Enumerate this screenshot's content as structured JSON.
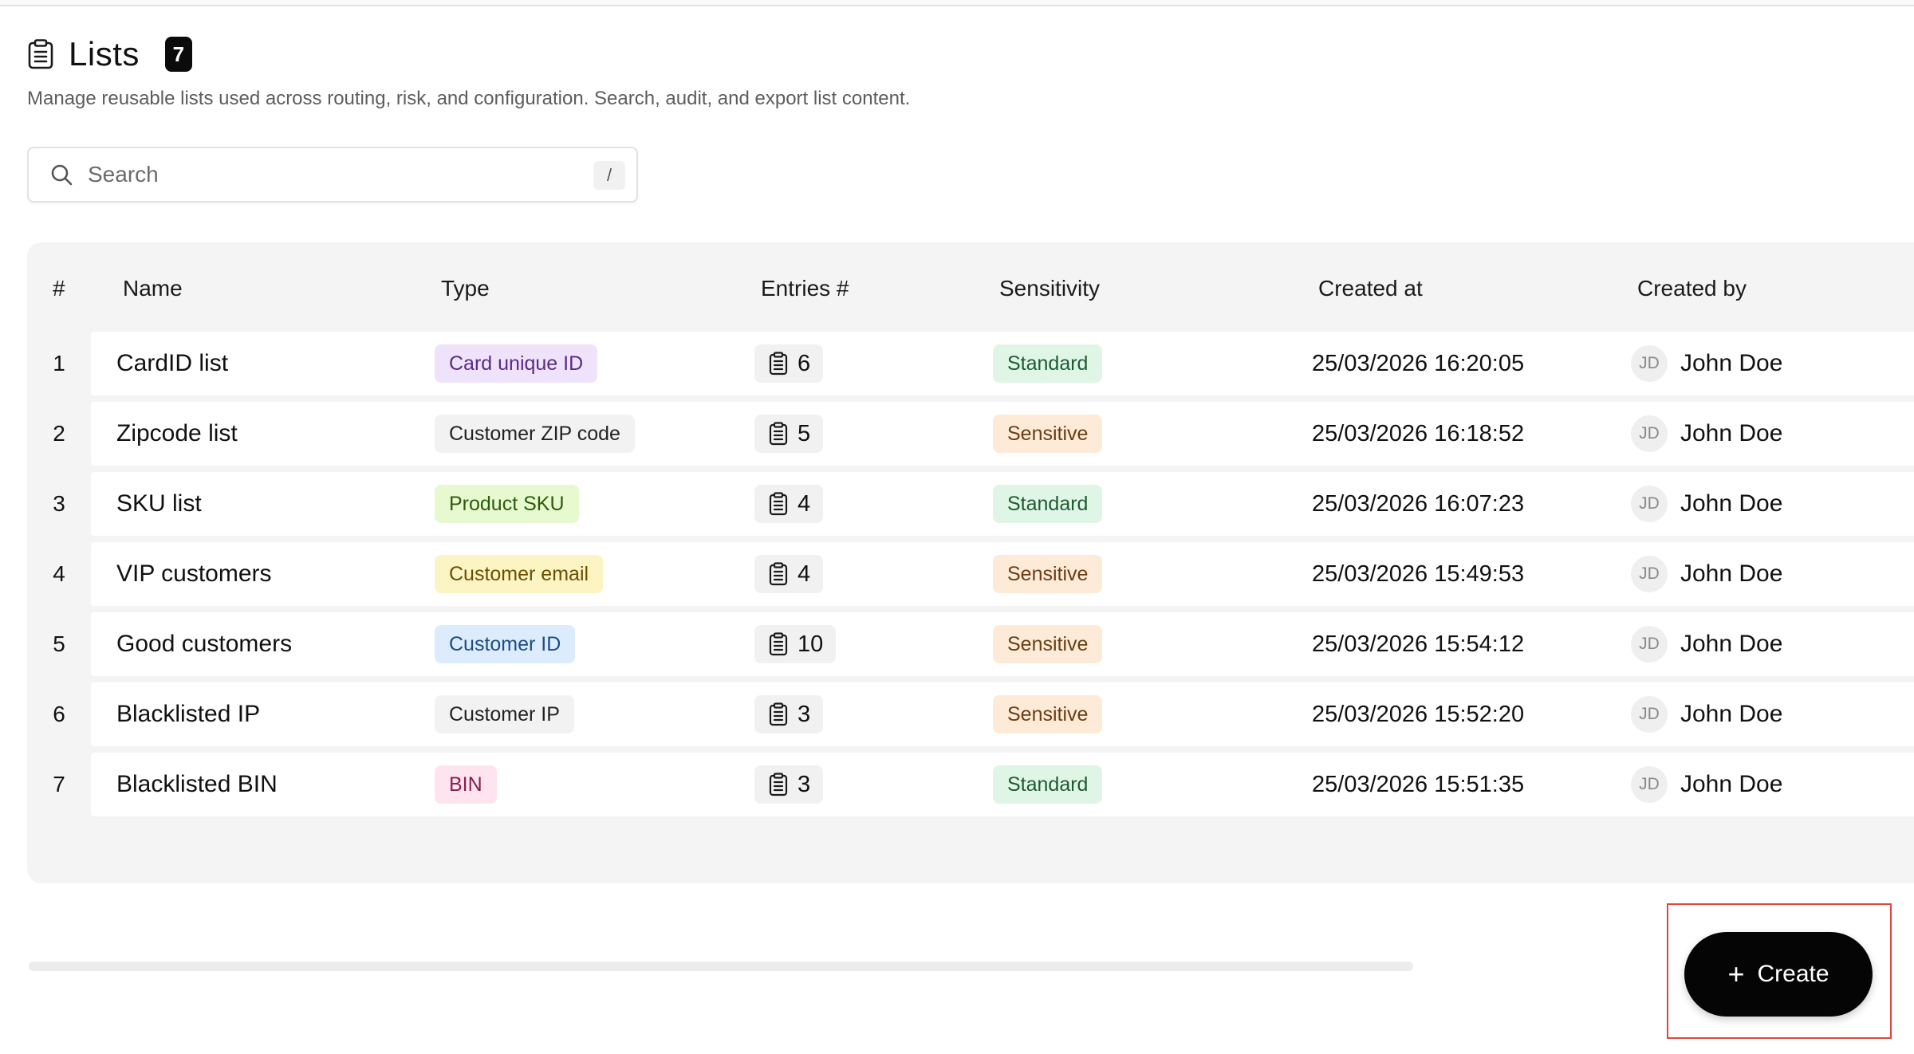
{
  "header": {
    "title": "Lists",
    "count": "7",
    "description": "Manage reusable lists used across routing, risk, and configuration. Search, audit, and export list content."
  },
  "search": {
    "placeholder": "Search",
    "shortcut": "/"
  },
  "table": {
    "columns": [
      "#",
      "Name",
      "Type",
      "Entries #",
      "Sensitivity",
      "Created at",
      "Created by"
    ],
    "rows": [
      {
        "num": "1",
        "name": "CardID list",
        "type": "Card unique ID",
        "entries": "6",
        "sensitivity": "Standard",
        "created_at": "25/03/2026 16:20:05",
        "initials": "JD",
        "created_by": "John Doe"
      },
      {
        "num": "2",
        "name": "Zipcode list",
        "type": "Customer ZIP code",
        "entries": "5",
        "sensitivity": "Sensitive",
        "created_at": "25/03/2026 16:18:52",
        "initials": "JD",
        "created_by": "John Doe"
      },
      {
        "num": "3",
        "name": "SKU list",
        "type": "Product SKU",
        "entries": "4",
        "sensitivity": "Standard",
        "created_at": "25/03/2026 16:07:23",
        "initials": "JD",
        "created_by": "John Doe"
      },
      {
        "num": "4",
        "name": "VIP customers",
        "type": "Customer email",
        "entries": "4",
        "sensitivity": "Sensitive",
        "created_at": "25/03/2026 15:49:53",
        "initials": "JD",
        "created_by": "John Doe"
      },
      {
        "num": "5",
        "name": "Good customers",
        "type": "Customer ID",
        "entries": "10",
        "sensitivity": "Sensitive",
        "created_at": "25/03/2026 15:54:12",
        "initials": "JD",
        "created_by": "John Doe"
      },
      {
        "num": "6",
        "name": "Blacklisted IP",
        "type": "Customer IP",
        "entries": "3",
        "sensitivity": "Sensitive",
        "created_at": "25/03/2026 15:52:20",
        "initials": "JD",
        "created_by": "John Doe"
      },
      {
        "num": "7",
        "name": "Blacklisted BIN",
        "type": "BIN",
        "entries": "3",
        "sensitivity": "Standard",
        "created_at": "25/03/2026 15:51:35",
        "initials": "JD",
        "created_by": "John Doe"
      }
    ]
  },
  "type_colors": {
    "Card unique ID": {
      "bg": "#efe3fb",
      "fg": "#5b2a86"
    },
    "Customer ZIP code": {
      "bg": "#f2f2f2",
      "fg": "#222222"
    },
    "Product SKU": {
      "bg": "#e6f9cf",
      "fg": "#2f5a0d"
    },
    "Customer email": {
      "bg": "#fdf4c4",
      "fg": "#6b4f00"
    },
    "Customer ID": {
      "bg": "#dcecfd",
      "fg": "#1d4c86"
    },
    "Customer IP": {
      "bg": "#f2f2f2",
      "fg": "#222222"
    },
    "BIN": {
      "bg": "#fde4ef",
      "fg": "#8a1f4e"
    }
  },
  "sensitivity_colors": {
    "Standard": {
      "bg": "#dff6e6",
      "fg": "#1f5a32"
    },
    "Sensitive": {
      "bg": "#fdebd8",
      "fg": "#6a3d12"
    }
  },
  "actions": {
    "create_label": "Create",
    "create_icon": "plus-icon"
  }
}
